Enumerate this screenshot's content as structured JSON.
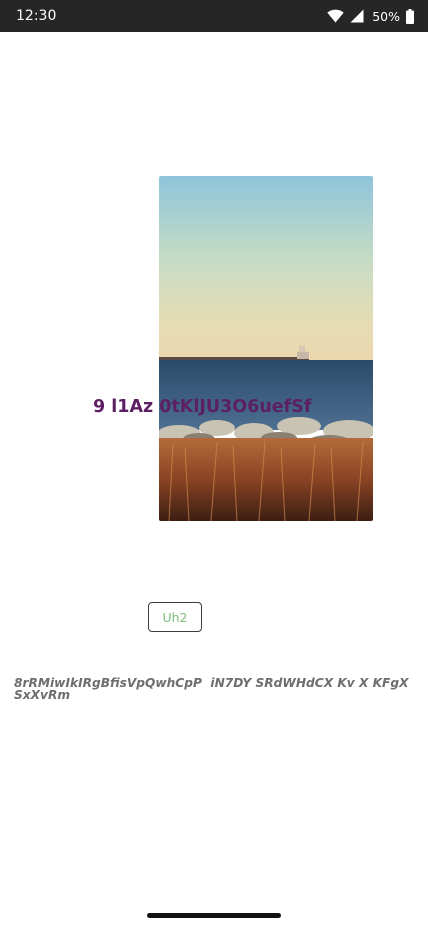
{
  "status_bar": {
    "time": "12:30",
    "battery": "50%",
    "icons": [
      "wifi-icon",
      "signal-icon",
      "battery-icon"
    ]
  },
  "photo": {
    "description_icon": "landscape-photo"
  },
  "overlay_text": "9 l1Az 0tKlJU3O6uefSf",
  "button": {
    "label": "Uh2"
  },
  "body_text": "8rRMiwIkIRgBfisVpQwhCpP  iN7DY SRdWHdCX Kv X KFgX SxXvRm",
  "colors": {
    "status_bar_bg": "#262626",
    "overlay_text": "#5c1f63",
    "button_text": "#7cbf7c",
    "body_text": "#6e6e6e"
  }
}
